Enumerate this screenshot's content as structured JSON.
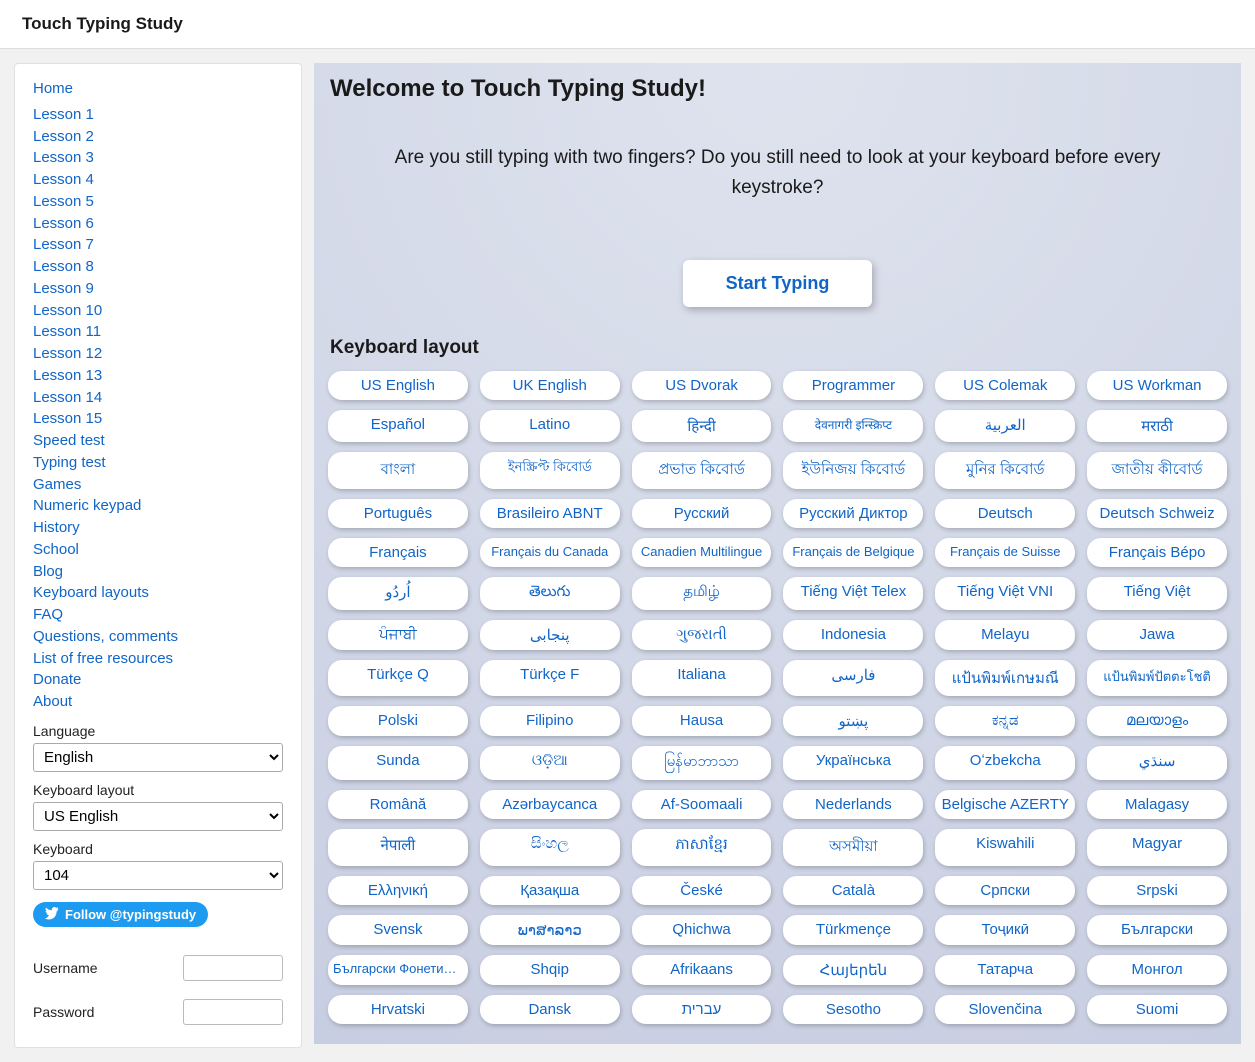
{
  "header": {
    "title": "Touch Typing Study"
  },
  "sidebar": {
    "nav_pre": [
      "Home",
      "Lesson 1",
      "Lesson 2",
      "Lesson 3",
      "Lesson 4",
      "Lesson 5",
      "Lesson 6",
      "Lesson 7",
      "Lesson 8",
      "Lesson 9",
      "Lesson 10",
      "Lesson 11",
      "Lesson 12",
      "Lesson 13",
      "Lesson 14",
      "Lesson 15"
    ],
    "nav_post": [
      "Speed test",
      "Typing test",
      "Games",
      "Numeric keypad",
      "History",
      "School",
      "Blog",
      "Keyboard layouts",
      "FAQ",
      "Questions, comments",
      "List of free resources",
      "Donate",
      "About"
    ],
    "language_label": "Language",
    "language_value": "English",
    "kblayout_label": "Keyboard layout",
    "kblayout_value": "US English",
    "keyboard_label": "Keyboard",
    "keyboard_value": "104",
    "twitter_label": "Follow @typingstudy",
    "username_label": "Username",
    "password_label": "Password"
  },
  "main": {
    "heading": "Welcome to Touch Typing Study!",
    "tagline": "Are you still typing with two fingers? Do you still need to look at your keyboard before every keystroke?",
    "start_label": "Start Typing",
    "kb_section_title": "Keyboard layout",
    "layouts": [
      "US English",
      "UK English",
      "US Dvorak",
      "Programmer",
      "US Colemak",
      "US Workman",
      "Español",
      "Latino",
      "हिन्दी",
      "देवनागरी इन्स्क्रिप्ट",
      "العربية",
      "मराठी",
      "বাংলা",
      "ইনস্ক্রিপ্ট কিবোর্ড",
      "প্রভাত কিবোর্ড",
      "ইউনিজয় কিবোর্ড",
      "মুনির কিবোর্ড",
      "জাতীয় কীবোর্ড",
      "Português",
      "Brasileiro ABNT",
      "Русский",
      "Русский Диктор",
      "Deutsch",
      "Deutsch Schweiz",
      "Français",
      "Français du Canada",
      "Canadien Multilingue",
      "Français de Belgique",
      "Français de Suisse",
      "Français Bépo",
      "اُردُو",
      "తెలుగు",
      "தமிழ்",
      "Tiếng Việt Telex",
      "Tiếng Việt VNI",
      "Tiếng Việt",
      "ਪੰਜਾਬੀ",
      "پنجابی",
      "ગુજરાતી",
      "Indonesia",
      "Melayu",
      "Jawa",
      "Türkçe Q",
      "Türkçe F",
      "Italiana",
      "فارسی",
      "แป้นพิมพ์เกษมณี",
      "แป้นพิมพ์ปัตตะโชติ",
      "Polski",
      "Filipino",
      "Hausa",
      "پښتو",
      "ಕನ್ನಡ",
      "മലയാളം",
      "Sunda",
      "ଓଡ଼ିଆ",
      "မြန်မာဘာသာ",
      "Українська",
      "Oʻzbekcha",
      "سنڌي",
      "Română",
      "Azərbaycanca",
      "Af-Soomaali",
      "Nederlands",
      "Belgische AZERTY",
      "Malagasy",
      "नेपाली",
      "සිංහල",
      "ភាសាខ្មែរ",
      "অসমীয়া",
      "Kiswahili",
      "Magyar",
      "Ελληνική",
      "Қазақша",
      "České",
      "Català",
      "Српски",
      "Srpski",
      "Svensk",
      "ພາສາລາວ",
      "Qhichwa",
      "Türkmençe",
      "Тоҷикӣ",
      "Български",
      "Български Фонетичен",
      "Shqip",
      "Afrikaans",
      "Հայերեն",
      "Татарча",
      "Монгол",
      "Hrvatski",
      "Dansk",
      "עברית",
      "Sesotho",
      "Slovenčina",
      "Suomi"
    ]
  }
}
